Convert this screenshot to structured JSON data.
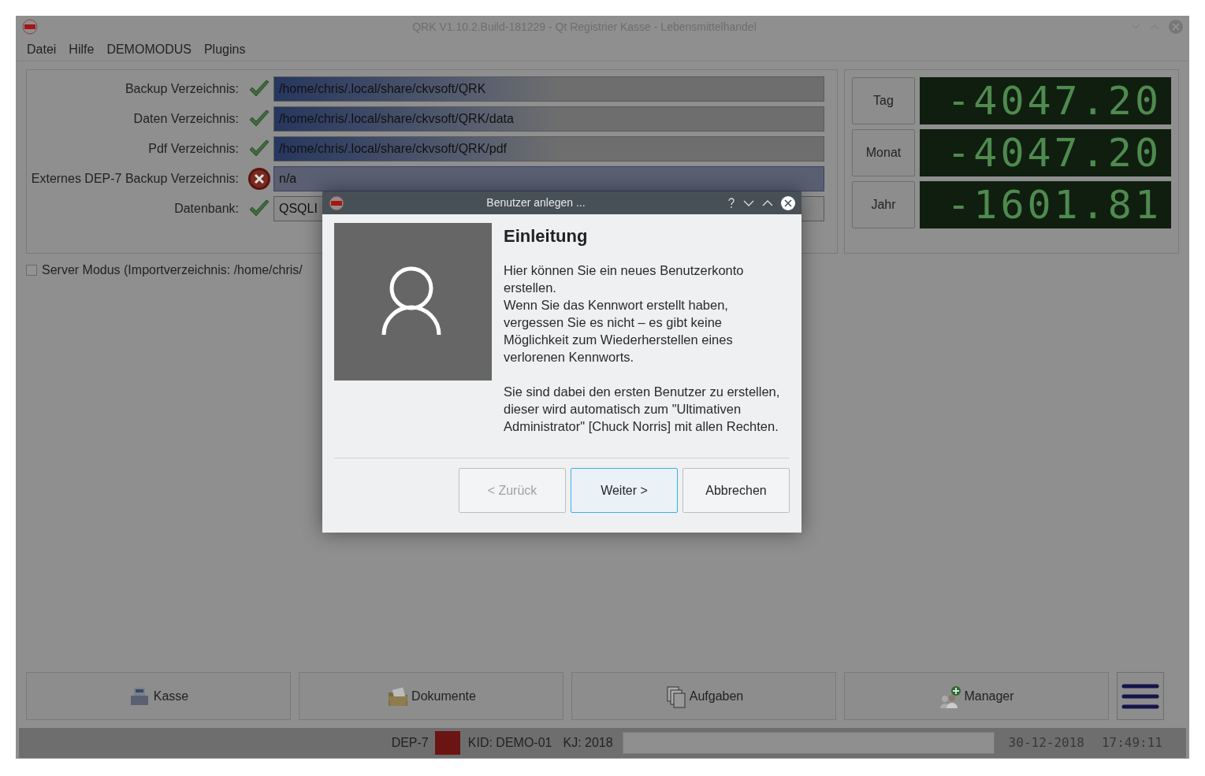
{
  "window": {
    "title": "QRK V1.10.2.Build-181229 - Qt Registrier Kasse - Lebensmittelhandel"
  },
  "menu": [
    {
      "label": "Datei"
    },
    {
      "label": "Hilfe"
    },
    {
      "label": "DEMOMODUS"
    },
    {
      "label": "Plugins"
    }
  ],
  "settings": [
    {
      "label": "Backup Verzeichnis:",
      "ok": true,
      "value": "/home/chris/.local/share/ckvsoft/QRK",
      "highlighted": true,
      "focused": false
    },
    {
      "label": "Daten Verzeichnis:",
      "ok": true,
      "value": "/home/chris/.local/share/ckvsoft/QRK/data",
      "highlighted": true,
      "focused": false
    },
    {
      "label": "Pdf Verzeichnis:",
      "ok": true,
      "value": "/home/chris/.local/share/ckvsoft/QRK/pdf",
      "highlighted": true,
      "focused": false
    },
    {
      "label": "Externes DEP-7 Backup Verzeichnis:",
      "ok": false,
      "value": "n/a",
      "highlighted": false,
      "focused": true
    },
    {
      "label": "Datenbank:",
      "ok": true,
      "value": "QSQLI",
      "highlighted": false,
      "focused": false
    }
  ],
  "totals": [
    {
      "label": "Tag",
      "value": "-4047.20"
    },
    {
      "label": "Monat",
      "value": "-4047.20"
    },
    {
      "label": "Jahr",
      "value": "-1601.81"
    }
  ],
  "server_mode": {
    "label": "Server Modus (Importverzeichnis: /home/chris/",
    "checked": false
  },
  "nav_buttons": [
    {
      "label": "Kasse",
      "kind": "register"
    },
    {
      "label": "Dokumente",
      "kind": "folder"
    },
    {
      "label": "Aufgaben",
      "kind": "documents"
    },
    {
      "label": "Manager",
      "kind": "user"
    },
    {
      "kind": "menu"
    }
  ],
  "status_bar": {
    "dep": "DEP-7",
    "dep_ok": false,
    "kid": "KID: DEMO-01",
    "kj": "KJ: 2018",
    "date": "30-12-2018",
    "time": "17:49:11"
  },
  "dialog": {
    "title": "Benutzer anlegen ...",
    "heading": "Einleitung",
    "paragraphs": [
      "Hier können Sie ein neues Benutzerkonto erstellen.",
      "Wenn Sie das Kennwort erstellt haben, vergessen Sie es nicht – es gibt keine Möglichkeit zum Wiederherstellen eines verlorenen Kennworts.",
      "Sie sind dabei den ersten Benutzer zu erstellen, dieser wird automatisch zum \"Ultimativen Administrator\" [Chuck Norris] mit allen Rechten."
    ],
    "buttons": [
      {
        "label": "< Zurück",
        "disabled": true,
        "default": false
      },
      {
        "label": "Weiter >",
        "disabled": false,
        "default": true
      },
      {
        "label": "Abbrechen",
        "disabled": false,
        "default": false
      }
    ]
  }
}
